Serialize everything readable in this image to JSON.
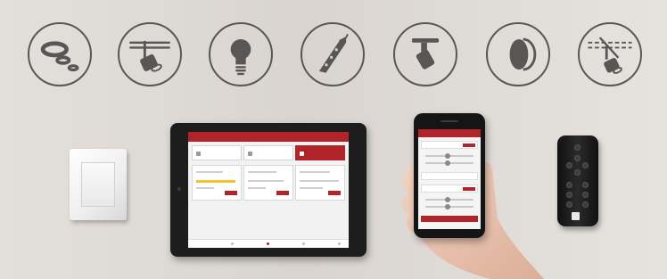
{
  "icons": [
    {
      "name": "recessed-rings-icon"
    },
    {
      "name": "rail-spotlight-icon"
    },
    {
      "name": "light-bulb-icon"
    },
    {
      "name": "led-strip-icon"
    },
    {
      "name": "ceiling-spot-icon"
    },
    {
      "name": "wall-disc-light-icon"
    },
    {
      "name": "wireless-rail-spotlight-icon"
    }
  ],
  "colors": {
    "icon_stroke": "#5a5655",
    "app_accent": "#b0242a",
    "background": "#dcd8d3"
  },
  "devices": [
    "wall-switch",
    "tablet-app",
    "smartphone-app",
    "remote-control"
  ]
}
